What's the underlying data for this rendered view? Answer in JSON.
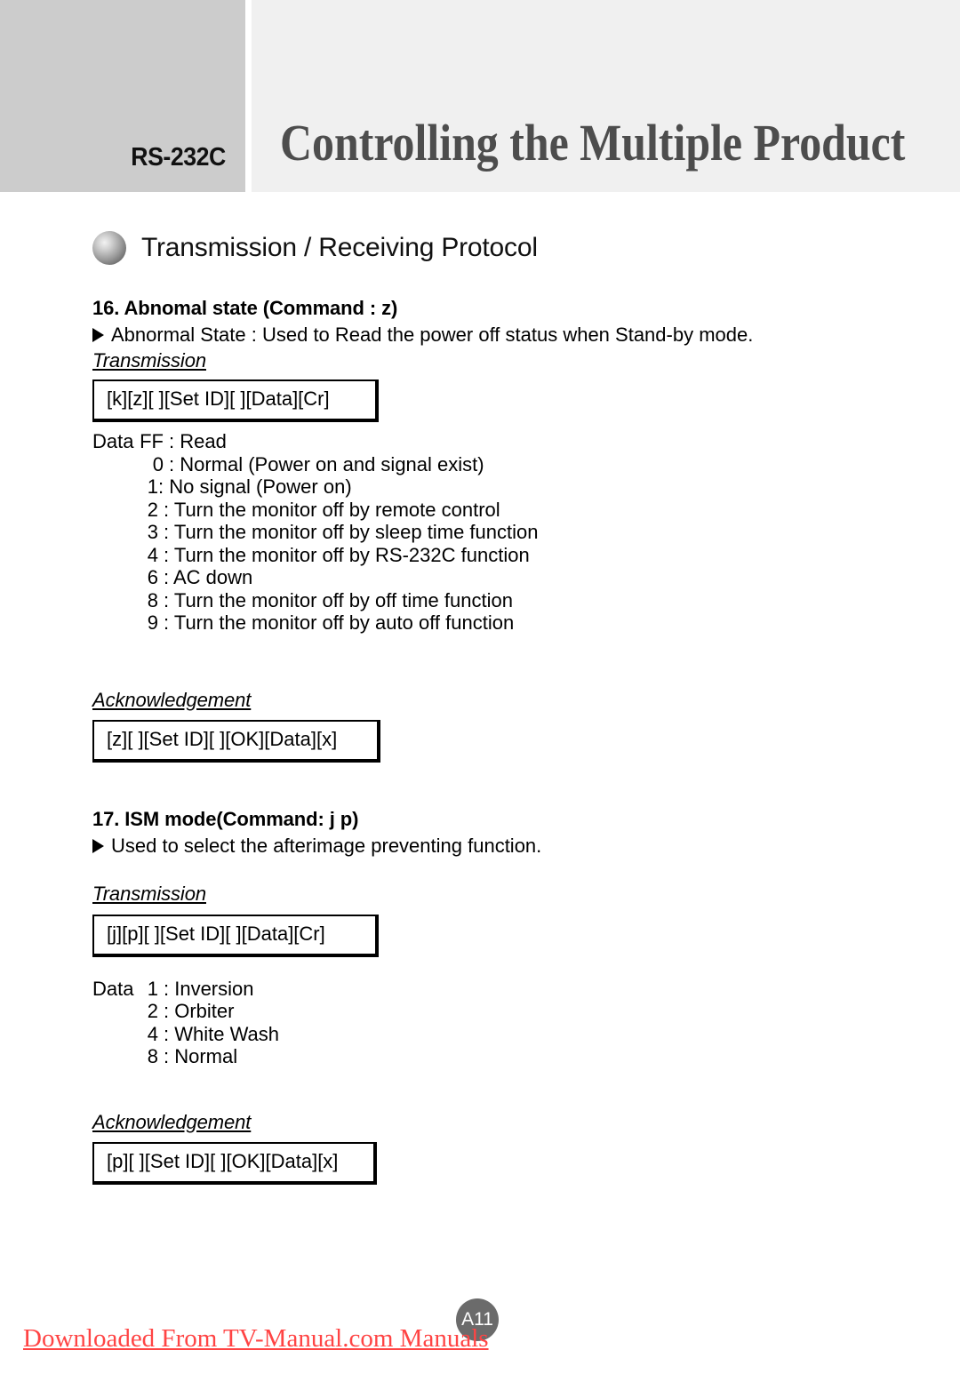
{
  "header": {
    "left_label": "RS-232C",
    "title": "Controlling the Multiple Product",
    "left_bg": "#cccccc",
    "right_bg": "#f0f0f0",
    "title_color": "#4d4d4d"
  },
  "section": {
    "bullet_icon": "sphere-bullet-icon",
    "heading": "Transmission / Receiving Protocol"
  },
  "commands": [
    {
      "title": "16. Abnomal state (Command : z)",
      "marker_icon": "triangle-right-icon",
      "description": "Abnormal State : Used to Read the power off status when Stand-by mode.",
      "transmission_label": "Transmission",
      "transmission_code": "[k][z][ ][Set ID][ ][Data][Cr]",
      "data_label": "Data",
      "data_items": [
        {
          "key": "FF",
          "value": ": Read"
        },
        {
          "key": "0",
          "value": ": Normal (Power on and signal exist)"
        },
        {
          "key": "1",
          "value": ": No signal (Power on)"
        },
        {
          "key": "2",
          "value": ": Turn the monitor off by remote control"
        },
        {
          "key": "3",
          "value": ": Turn the monitor off by sleep time function"
        },
        {
          "key": "4",
          "value": ": Turn the monitor off by RS-232C function"
        },
        {
          "key": "6",
          "value": ": AC down"
        },
        {
          "key": "8",
          "value": ": Turn the monitor off by off time function"
        },
        {
          "key": "9",
          "value": ": Turn the monitor off by auto off function"
        }
      ],
      "ack_label": "Acknowledgement",
      "ack_code": "[z][ ][Set ID][ ][OK][Data][x]"
    },
    {
      "title": "17. ISM mode(Command: j p)",
      "marker_icon": "triangle-right-icon",
      "description": "Used to select the afterimage preventing function.",
      "transmission_label": "Transmission",
      "transmission_code": "[j][p][ ][Set ID][ ][Data][Cr]",
      "data_label": "Data",
      "data_items": [
        {
          "key": "1",
          "value": ": Inversion"
        },
        {
          "key": "2",
          "value": ": Orbiter"
        },
        {
          "key": "4",
          "value": ": White Wash"
        },
        {
          "key": "8",
          "value": ": Normal"
        }
      ],
      "ack_label": "Acknowledgement",
      "ack_code": "[p][ ][Set ID][ ][OK][Data][x]"
    }
  ],
  "footer": {
    "page_number": "A11",
    "watermark": "Downloaded From TV-Manual.com Manuals",
    "watermark_color": "#ff4444",
    "badge_color": "#6b6b6b"
  }
}
